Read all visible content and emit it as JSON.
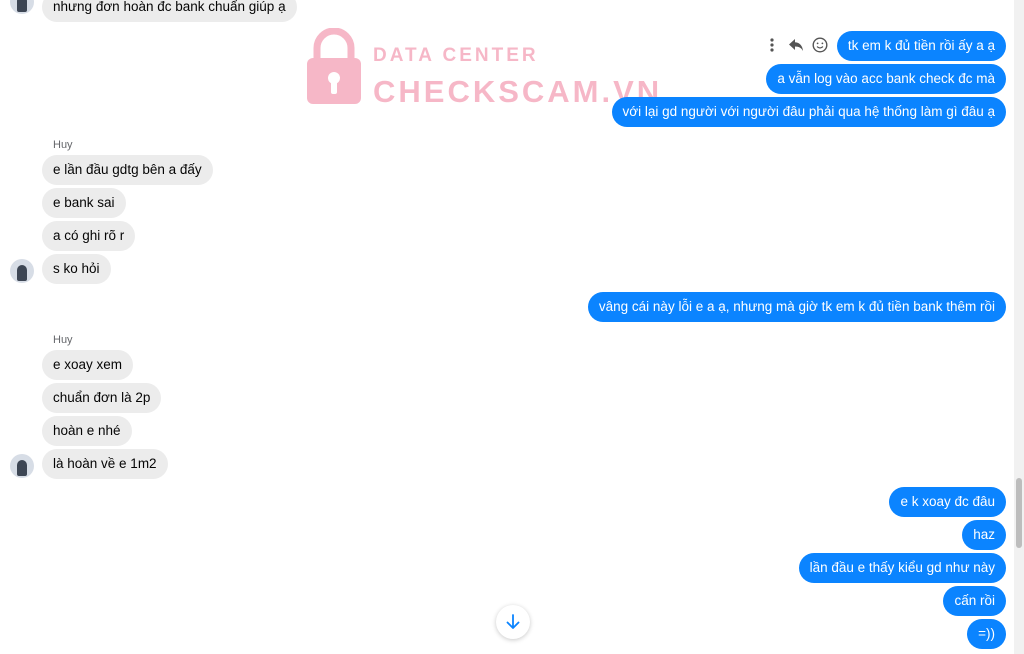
{
  "watermark": {
    "line1": "DATA CENTER",
    "line2": "CHECKSCAM.VN"
  },
  "top_partial_message": "nhưng đơn hoàn đc bank chuẩn giúp ạ",
  "groups": [
    {
      "sender": "Huy",
      "messages": [
        "e lần đầu gdtg bên a đấy",
        "e bank sai",
        "a có ghi rõ r",
        "s ko hỏi"
      ]
    },
    {
      "sender": "Huy",
      "messages": [
        "e xoay xem",
        "chuẩn đơn là 2p",
        "hoàn e nhé",
        "là hoàn về e 1m2"
      ]
    }
  ],
  "outgoing": [
    "tk em k đủ tiền rồi ấy a ạ",
    "a vẫn log  vào acc bank check đc mà",
    "với lại gd người với người đâu phải qua hệ thống làm gì đâu ạ",
    "vâng cái này lỗi e a ạ, nhưng mà giờ tk em k đủ tiền bank thêm rồi",
    "e k xoay đc đâu",
    "haz",
    "lần đầu e thấy kiểu gd như này",
    "cấn rồi",
    "=))"
  ],
  "icons": {
    "more": "more-vertical-icon",
    "reply": "reply-icon",
    "react": "smiley-icon",
    "scroll": "arrow-down-icon"
  },
  "colors": {
    "outgoing": "#0b84ff",
    "incoming": "#ececec",
    "watermark": "#f07e9a"
  }
}
